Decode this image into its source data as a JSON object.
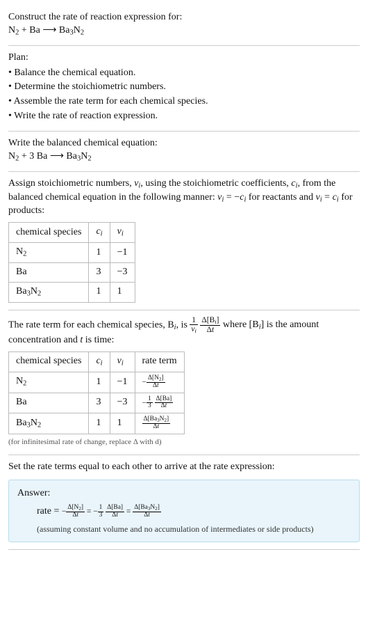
{
  "intro": {
    "title": "Construct the rate of reaction expression for:",
    "equation_html": "N<sub>2</sub> + Ba ⟶ Ba<sub>3</sub>N<sub>2</sub>"
  },
  "plan": {
    "title": "Plan:",
    "items": [
      "Balance the chemical equation.",
      "Determine the stoichiometric numbers.",
      "Assemble the rate term for each chemical species.",
      "Write the rate of reaction expression."
    ]
  },
  "balanced": {
    "title": "Write the balanced chemical equation:",
    "equation_html": "N<sub>2</sub> + 3 Ba ⟶ Ba<sub>3</sub>N<sub>2</sub>"
  },
  "stoich": {
    "text_html": "Assign stoichiometric numbers, <span class='ital'>ν<sub>i</sub></span>, using the stoichiometric coefficients, <span class='ital'>c<sub>i</sub></span>, from the balanced chemical equation in the following manner: <span class='ital'>ν<sub>i</sub></span> = −<span class='ital'>c<sub>i</sub></span> for reactants and <span class='ital'>ν<sub>i</sub></span> = <span class='ital'>c<sub>i</sub></span> for products:",
    "headers": {
      "species": "chemical species",
      "ci_html": "<span class='ital'>c<sub>i</sub></span>",
      "vi_html": "<span class='ital'>ν<sub>i</sub></span>"
    },
    "rows": [
      {
        "species_html": "N<sub>2</sub>",
        "ci": "1",
        "vi": "−1"
      },
      {
        "species_html": "Ba",
        "ci": "3",
        "vi": "−3"
      },
      {
        "species_html": "Ba<sub>3</sub>N<sub>2</sub>",
        "ci": "1",
        "vi": "1"
      }
    ]
  },
  "rateterms": {
    "text_pre": "The rate term for each chemical species, B",
    "text_mid": ", is ",
    "text_post_html": " where [B<sub><span class='ital'>i</span></sub>] is the amount concentration and <span class='ital'>t</span> is time:",
    "headers": {
      "species": "chemical species",
      "ci_html": "<span class='ital'>c<sub>i</sub></span>",
      "vi_html": "<span class='ital'>ν<sub>i</sub></span>",
      "rate": "rate term"
    },
    "rows": [
      {
        "species_html": "N<sub>2</sub>",
        "ci": "1",
        "vi": "−1",
        "rate_html": "−<span class='frac'><span class='num'>Δ[N<sub>2</sub>]</span><span class='den'>Δ<span class='ital'>t</span></span></span>"
      },
      {
        "species_html": "Ba",
        "ci": "3",
        "vi": "−3",
        "rate_html": "−<span class='frac'><span class='num'>1</span><span class='den'>3</span></span> <span class='frac'><span class='num'>Δ[Ba]</span><span class='den'>Δ<span class='ital'>t</span></span></span>"
      },
      {
        "species_html": "Ba<sub>3</sub>N<sub>2</sub>",
        "ci": "1",
        "vi": "1",
        "rate_html": "<span class='frac'><span class='num'>Δ[Ba<sub>3</sub>N<sub>2</sub>]</span><span class='den'>Δ<span class='ital'>t</span></span></span>"
      }
    ],
    "footnote": "(for infinitesimal rate of change, replace Δ with d)"
  },
  "final": {
    "title": "Set the rate terms equal to each other to arrive at the rate expression:",
    "answer_label": "Answer:",
    "rate_label": "rate = ",
    "expr_html": "−<span class='frac'><span class='num'>Δ[N<sub>2</sub>]</span><span class='den'>Δ<span class='ital'>t</span></span></span> = −<span class='frac'><span class='num'>1</span><span class='den'>3</span></span> <span class='frac'><span class='num'>Δ[Ba]</span><span class='den'>Δ<span class='ital'>t</span></span></span> = <span class='frac'><span class='num'>Δ[Ba<sub>3</sub>N<sub>2</sub>]</span><span class='den'>Δ<span class='ital'>t</span></span></span>",
    "note": "(assuming constant volume and no accumulation of intermediates or side products)"
  }
}
